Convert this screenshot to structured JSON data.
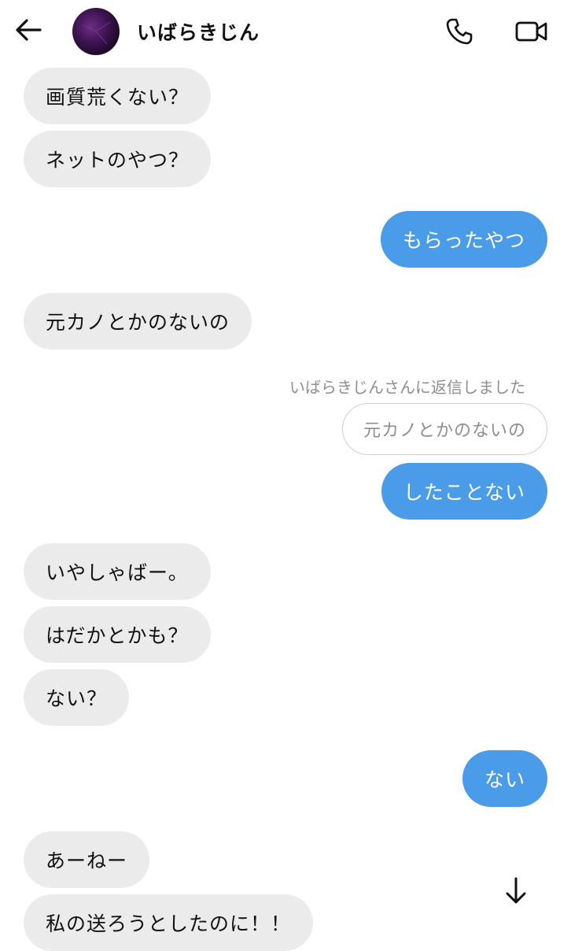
{
  "header": {
    "contact_name": "いばらきじん",
    "back_icon": "arrow-left-icon",
    "phone_icon": "phone-icon",
    "video_icon": "video-camera-icon"
  },
  "messages": [
    {
      "side": "in",
      "text": "画質荒くない？"
    },
    {
      "side": "in",
      "text": "ネットのやつ？"
    },
    {
      "side": "out",
      "text": "もらったやつ"
    },
    {
      "side": "in",
      "text": "元カノとかのないの"
    },
    {
      "side": "out",
      "text": "したことない",
      "reply_caption": "いばらきじんさんに返信しました",
      "reply_quote": "元カノとかのないの"
    },
    {
      "side": "in",
      "text": "いやしゃばー。"
    },
    {
      "side": "in",
      "text": "はだかとかも？"
    },
    {
      "side": "in",
      "text": "ない？"
    },
    {
      "side": "out",
      "text": "ない"
    },
    {
      "side": "in",
      "text": "あーねー"
    },
    {
      "side": "in",
      "text": "私の送ろうとしたのに！！"
    }
  ],
  "colors": {
    "incoming_bubble": "#ebebeb",
    "outgoing_bubble": "#4a9be8",
    "meta_text": "#8e8e8e"
  },
  "scroll_icon": "arrow-down-icon"
}
